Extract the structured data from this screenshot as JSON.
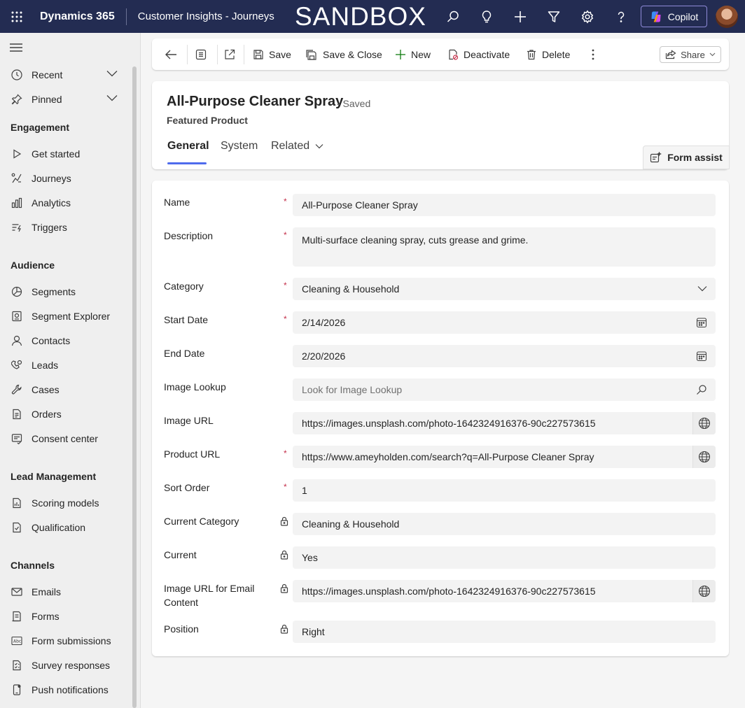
{
  "topbar": {
    "brand": "Dynamics 365",
    "app_name": "Customer Insights - Journeys",
    "environment_banner": "SANDBOX",
    "copilot_label": "Copilot"
  },
  "sidebar": {
    "top_items": [
      {
        "label": "Recent",
        "icon": "clock-icon"
      },
      {
        "label": "Pinned",
        "icon": "pin-icon"
      }
    ],
    "groups": [
      {
        "title": "Engagement",
        "items": [
          {
            "label": "Get started",
            "icon": "play-icon"
          },
          {
            "label": "Journeys",
            "icon": "journey-icon"
          },
          {
            "label": "Analytics",
            "icon": "analytics-icon"
          },
          {
            "label": "Triggers",
            "icon": "trigger-icon"
          }
        ]
      },
      {
        "title": "Audience",
        "items": [
          {
            "label": "Segments",
            "icon": "segments-icon"
          },
          {
            "label": "Segment Explorer",
            "icon": "segment-explorer-icon"
          },
          {
            "label": "Contacts",
            "icon": "person-icon"
          },
          {
            "label": "Leads",
            "icon": "leads-icon"
          },
          {
            "label": "Cases",
            "icon": "wrench-icon"
          },
          {
            "label": "Orders",
            "icon": "document-icon"
          },
          {
            "label": "Consent center",
            "icon": "consent-icon"
          }
        ]
      },
      {
        "title": "Lead Management",
        "items": [
          {
            "label": "Scoring models",
            "icon": "scoring-icon"
          },
          {
            "label": "Qualification",
            "icon": "qualification-icon"
          }
        ]
      },
      {
        "title": "Channels",
        "items": [
          {
            "label": "Emails",
            "icon": "mail-icon"
          },
          {
            "label": "Forms",
            "icon": "form-icon"
          },
          {
            "label": "Form submissions",
            "icon": "form-submissions-icon"
          },
          {
            "label": "Survey responses",
            "icon": "survey-icon"
          },
          {
            "label": "Push notifications",
            "icon": "push-icon"
          }
        ]
      }
    ]
  },
  "commandbar": {
    "save": "Save",
    "save_close": "Save & Close",
    "new": "New",
    "deactivate": "Deactivate",
    "delete": "Delete",
    "share": "Share"
  },
  "record": {
    "title": "All-Purpose Cleaner Spray",
    "status": "- Saved",
    "entity": "Featured Product",
    "tabs": [
      "General",
      "System",
      "Related"
    ],
    "form_assist": "Form assist"
  },
  "form": {
    "fields": [
      {
        "label": "Name",
        "value": "All-Purpose Cleaner Spray",
        "marker": "required"
      },
      {
        "label": "Description",
        "value": "Multi-surface cleaning spray, cuts grease and grime.",
        "marker": "required"
      },
      {
        "label": "Category",
        "value": "Cleaning & Household",
        "marker": "required"
      },
      {
        "label": "Start Date",
        "value": "2/14/2026",
        "marker": "required"
      },
      {
        "label": "End Date",
        "value": "2/20/2026",
        "marker": "none"
      },
      {
        "label": "Image Lookup",
        "placeholder": "Look for Image Lookup",
        "marker": "none"
      },
      {
        "label": "Image URL",
        "value": "https://images.unsplash.com/photo-1642324916376-90c227573615",
        "marker": "none"
      },
      {
        "label": "Product URL",
        "value": "https://www.ameyholden.com/search?q=All-Purpose Cleaner Spray",
        "marker": "recommended"
      },
      {
        "label": "Sort Order",
        "value": "1",
        "marker": "required"
      },
      {
        "label": "Current Category",
        "value": "Cleaning & Household",
        "marker": "locked"
      },
      {
        "label": "Current",
        "value": "Yes",
        "marker": "locked"
      },
      {
        "label": "Image URL for Email Content",
        "value": "https://images.unsplash.com/photo-1642324916376-90c227573615",
        "marker": "locked"
      },
      {
        "label": "Position",
        "value": "Right",
        "marker": "locked"
      }
    ],
    "required_marker": "*"
  },
  "colors": {
    "topbar": "#232c52",
    "accent": "#4f6bed",
    "required": "#c4314b"
  }
}
